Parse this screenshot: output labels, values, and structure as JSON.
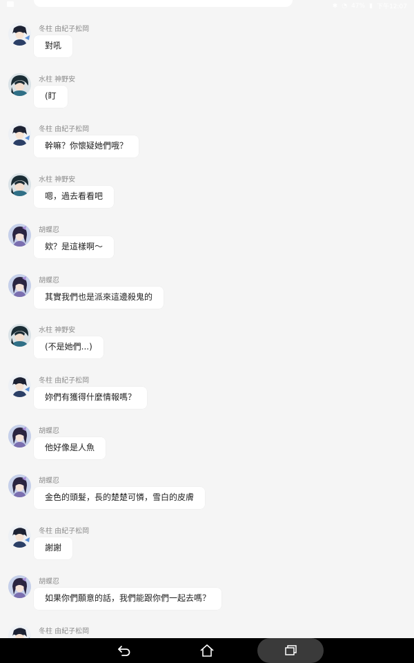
{
  "status_bar": {
    "time": "下午12:07",
    "battery": "47%"
  },
  "messages": [
    {
      "avatar": "tomioka-avatar",
      "sender": "冬柱 由紀子松岡",
      "text": "對吼"
    },
    {
      "avatar": "water-avatar",
      "sender": "水柱 神野安",
      "text": "(盯"
    },
    {
      "avatar": "tomioka-avatar",
      "sender": "冬柱 由紀子松岡",
      "text": "幹嘛？你懷疑她們哦？"
    },
    {
      "avatar": "water-avatar",
      "sender": "水柱 神野安",
      "text": "嗯，過去看看吧"
    },
    {
      "avatar": "shinobu-avatar",
      "sender": "胡蝶忍",
      "text": "欸？是這樣啊～"
    },
    {
      "avatar": "shinobu-avatar",
      "sender": "胡蝶忍",
      "text": "其實我們也是派來這邊殺鬼的"
    },
    {
      "avatar": "water-avatar",
      "sender": "水柱 神野安",
      "text": "(不是她們...)"
    },
    {
      "avatar": "tomioka-avatar",
      "sender": "冬柱 由紀子松岡",
      "text": "妳們有獲得什麼情報嗎？"
    },
    {
      "avatar": "shinobu-avatar",
      "sender": "胡蝶忍",
      "text": "他好像是人魚"
    },
    {
      "avatar": "shinobu-avatar",
      "sender": "胡蝶忍",
      "text": "金色的頭髮，長的楚楚可憐，雪白的皮膚"
    },
    {
      "avatar": "tomioka-avatar",
      "sender": "冬柱 由紀子松岡",
      "text": "謝謝"
    },
    {
      "avatar": "shinobu-avatar",
      "sender": "胡蝶忍",
      "text": "如果你們願意的話，我們能跟你們一起去嗎？"
    },
    {
      "avatar": "tomioka-avatar",
      "sender": "冬柱 由紀子松岡",
      "text": ""
    }
  ],
  "nav_bar": {
    "back_icon": "back-icon",
    "home_icon": "home-icon",
    "recent_icon": "recent-apps-icon"
  }
}
